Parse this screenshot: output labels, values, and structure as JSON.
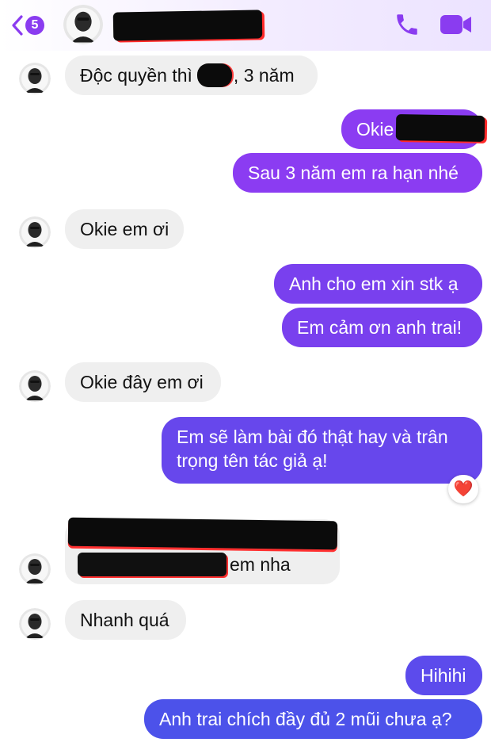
{
  "header": {
    "unread_count": "5",
    "contact_name": "",
    "icons": {
      "back": "chevron-left-icon",
      "call": "phone-icon",
      "video": "video-camera-icon"
    }
  },
  "colors": {
    "accent": "#8a3cf0",
    "incoming_bubble": "#efefef",
    "outgoing_top": "#8b3cf2",
    "outgoing_bottom": "#4c52ea"
  },
  "messages": [
    {
      "from": "them",
      "before_redaction": "Độc quyền thì",
      "after_redaction": ", 3 năm"
    },
    {
      "from": "me",
      "text": "Okie"
    },
    {
      "from": "me",
      "text": "Sau 3 năm em ra hạn nhé"
    },
    {
      "from": "them",
      "text": "Okie em ơi"
    },
    {
      "from": "me",
      "text": "Anh cho em xin stk ạ"
    },
    {
      "from": "me",
      "text": "Em cảm ơn anh trai!"
    },
    {
      "from": "them",
      "text": "Okie đây em ơi"
    },
    {
      "from": "me",
      "text": "Em sẽ làm bài đó thật hay và trân trọng tên tác giả ạ!",
      "reaction": "❤️"
    },
    {
      "from": "them",
      "text": "em nha"
    },
    {
      "from": "them",
      "text": "Nhanh quá"
    },
    {
      "from": "me",
      "text": "Hihihi"
    },
    {
      "from": "me",
      "text": "Anh trai chích đầy đủ 2 mũi chưa ạ?"
    }
  ]
}
